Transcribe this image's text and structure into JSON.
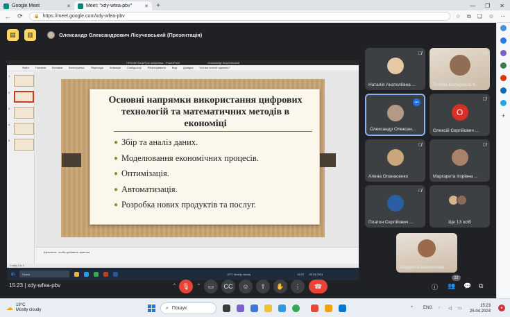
{
  "browser": {
    "tabs": [
      {
        "label": "Google Meet",
        "active": false,
        "favicon_color": "#00897b"
      },
      {
        "label": "Meet: \"xdy-wfea-pbv\"",
        "active": true,
        "favicon_color": "#00897b"
      }
    ],
    "new_tab_glyph": "+",
    "url": "https://meet.google.com/xdy-wfea-pbv"
  },
  "meet": {
    "presenter_label": "Олександр Олександрович Лісучевський (Презентація)",
    "meeting_code": "15:23 | xdy-wfea-pbv",
    "participants_count": "22",
    "accent": "#fdd663",
    "hangup_color": "#ea4335"
  },
  "slide": {
    "app_title": "ПРЕЗЕНТАЦІЯ до цифровки - PowerPoint",
    "user": "Олександр Лісучевський",
    "menu": [
      "Файл",
      "Головна",
      "Вставка",
      "Конструктор",
      "Переходи",
      "Анімація",
      "Слайд-шоу",
      "Рецензування",
      "Вид",
      "Довідка",
      "Что вы хотите сделать?"
    ],
    "title_lines": [
      "Основні напрямки використання цифрових",
      "технологій та математичних методів в",
      "економіці"
    ],
    "bullets": [
      "Збір та аналіз даних.",
      "Моделювання економічних процесів.",
      "Оптимізація.",
      "Автоматизація.",
      "Розробка нових продуктів та послуг."
    ],
    "notes_hint": "Щелкните, чтобы добавить заметки",
    "status_left": "Слайд 2 из 5",
    "inner_taskbar_search": "Поиск",
    "inner_weather": "19°C Mostly cloudy",
    "inner_time": "15:22",
    "inner_date": "25.04.2024",
    "thumb_numbers": [
      "1",
      "2",
      "3",
      "4",
      "5"
    ]
  },
  "participants": [
    {
      "name": "Наталія Анатоліївна ...",
      "type": "photo",
      "color": "#e8c9a5"
    },
    {
      "name": "Тетяна Валеріївна К...",
      "type": "video",
      "color": "#d6cbbd"
    },
    {
      "name": "Олександр Олексан...",
      "type": "photo",
      "color": "#b49a86",
      "speaking": true
    },
    {
      "name": "Олексій Сергійович ...",
      "type": "letter",
      "letter": "О"
    },
    {
      "name": "Алена Опанасенко",
      "type": "photo",
      "color": "#c9a67c"
    },
    {
      "name": "Маргарита Ігорівна ...",
      "type": "photo",
      "color": "#a8826a"
    },
    {
      "name": "Платон Сергійович ...",
      "type": "photo",
      "color": "#2b5fa3"
    },
    {
      "name": "Ще 13 осіб",
      "type": "more"
    },
    {
      "name": "Людмила Валентинів...",
      "type": "video",
      "color": "#c7b19a"
    }
  ],
  "taskbar": {
    "weather_temp": "19°C",
    "weather_text": "Mostly cloudy",
    "search_placeholder": "Пошук",
    "lang": "ENG",
    "time": "15:23",
    "date": "25.04.2024"
  },
  "icons": {
    "back": "←",
    "reload": "⟳",
    "lock": "🔒",
    "mic_off": "🎤",
    "camera": "⌐",
    "hand": "✋",
    "more": "⋮",
    "hangup": "☎",
    "info": "ⓘ",
    "people": "👥"
  }
}
